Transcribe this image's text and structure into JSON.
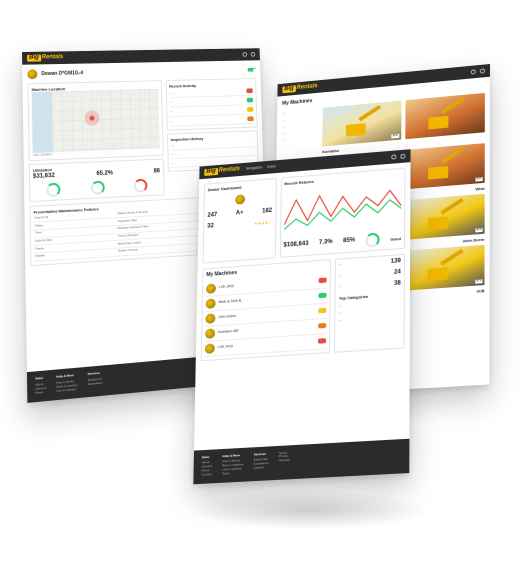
{
  "brand": {
    "big": "Big",
    "rentals": "Rentals"
  },
  "back_left": {
    "customer_title": "Dewan D*GM1G-4",
    "machine_location": "Machine Location",
    "last_updated": "Last Updated",
    "utilization": "Utilization",
    "stats": [
      "$31,632",
      "65.2%",
      "86"
    ],
    "preventative_title": "Preventative Maintenance Policies",
    "recent_activity": "Recent Activity",
    "inspection_history": "Inspection History",
    "table_rows": [
      [
        "Fuel & Oil",
        "Safety Check & Service"
      ],
      [
        "Filters",
        "Hydraulic Filter"
      ],
      [
        "Tires",
        "Replace Hydraulic Filter"
      ],
      [
        "Lube & Filter",
        "Tires & Rotation"
      ],
      [
        "Tracks",
        "Belt/Chain Check"
      ],
      [
        "Engine",
        "Engine Service"
      ]
    ]
  },
  "back_right": {
    "title": "My Machines",
    "cards": [
      {
        "name": "Komatsu",
        "price": "$90"
      },
      {
        "name": "Wiwi",
        "price": "$45"
      },
      {
        "name": "John Deere",
        "price": "$55"
      },
      {
        "name": "JCB",
        "price": "$70"
      }
    ]
  },
  "front": {
    "nav": [
      "Navigation",
      "Sales"
    ],
    "dealer_title": "Dealer Dashboard",
    "recent_returns": "Recent Returns",
    "stats": [
      "247",
      "A+",
      "182"
    ],
    "stats2": [
      "$108,843",
      "7.3%",
      "85%"
    ],
    "good_label": "Good",
    "rating_value": "32",
    "my_machines": "My Machines",
    "machines": [
      {
        "name": "LXK 2402",
        "status": "red"
      },
      {
        "name": "Beck & Seth B.",
        "status": "green"
      },
      {
        "name": "John Deere",
        "status": "yellow"
      },
      {
        "name": "Komatsu 46F",
        "status": "orange"
      },
      {
        "name": "LXK 2410",
        "status": "red"
      }
    ],
    "top_categories": "Top Categories",
    "side_stats": [
      "139",
      "24",
      "38"
    ]
  },
  "footer": {
    "col1": [
      "About",
      "Careers",
      "Press",
      "Contact"
    ],
    "col2": [
      "How it Works",
      "Rent a machine",
      "List a machine",
      "Sales"
    ],
    "col3": [
      "Equipment",
      "Excavators",
      "Loaders"
    ],
    "col4": [
      "Terms",
      "Privacy",
      "Sitemap"
    ],
    "headers": [
      "Sales",
      "Help & More",
      "Services",
      ""
    ]
  },
  "colors": {
    "accent": "#f3c10d",
    "dark": "#2b2b2b"
  }
}
